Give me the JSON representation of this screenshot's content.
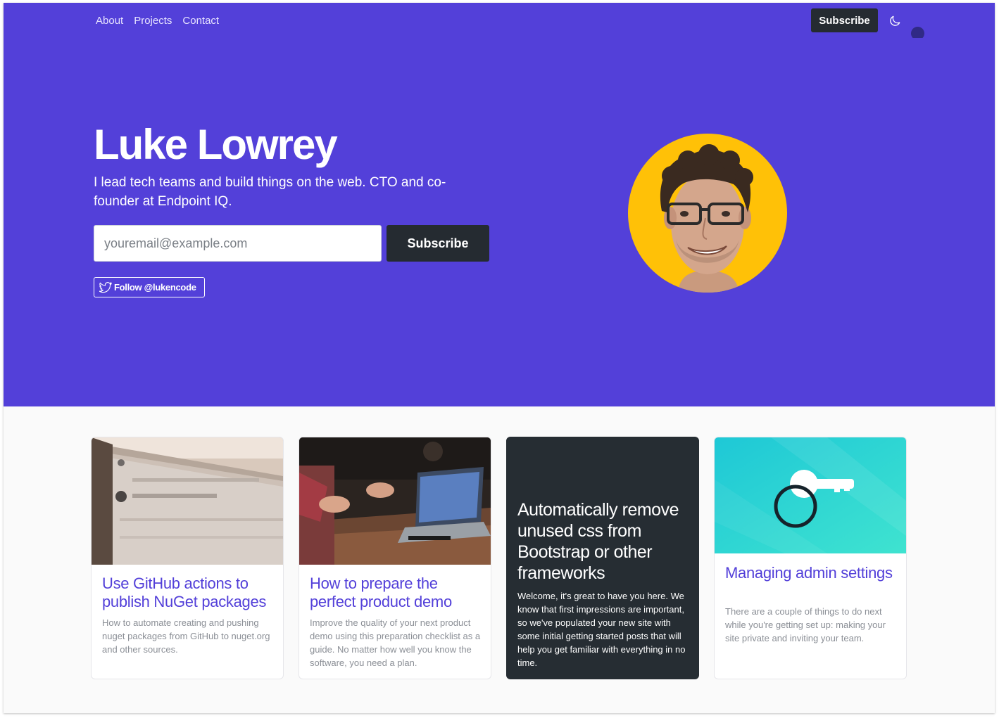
{
  "nav": {
    "links": [
      "About",
      "Projects",
      "Contact"
    ],
    "subscribe_label": "Subscribe",
    "theme_icon": "moon-icon"
  },
  "hero": {
    "title": "Luke Lowrey",
    "subtitle": "I lead tech teams and build things on the web. CTO and co-founder at Endpoint IQ.",
    "email_placeholder": "youremail@example.com",
    "subscribe_label": "Subscribe",
    "follow_label": "Follow @lukencode",
    "background_color": "#5340d9"
  },
  "cards": [
    {
      "title": "Use GitHub actions to publish NuGet packages",
      "description": "How to automate creating and pushing nuget packages from GitHub to nuget.org and other sources."
    },
    {
      "title": "How to prepare the perfect product demo",
      "description": "Improve the quality of your next product demo using this preparation checklist as a guide. No matter how well you know the software, you need a plan."
    },
    {
      "title": "Automatically remove unused css from Bootstrap or other frameworks",
      "description": "Welcome, it's great to have you here. We know that first impressions are important, so we've populated your new site with some initial getting started posts that will help you get familiar with everything in no time."
    },
    {
      "title": "Managing admin settings",
      "description": "There are a couple of things to do next while you're getting set up: making your site private and inviting your team."
    }
  ]
}
